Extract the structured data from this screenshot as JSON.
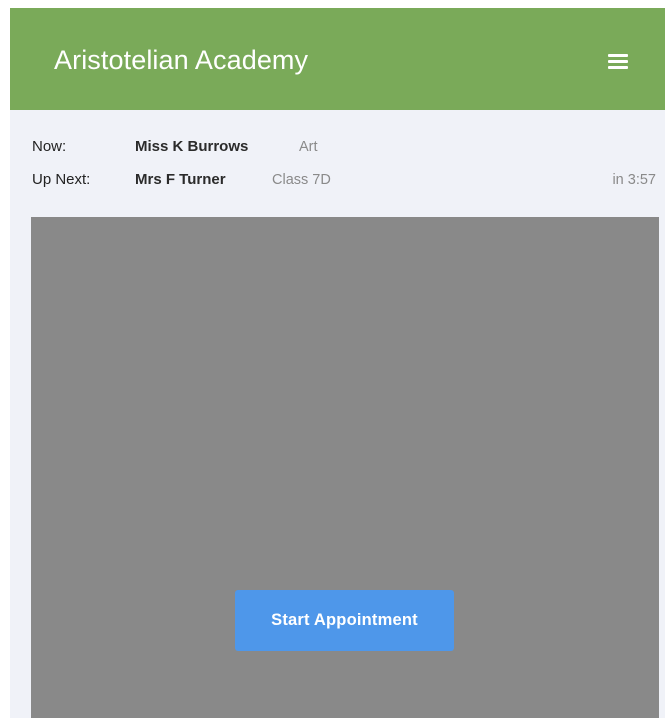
{
  "header": {
    "title": "Aristotelian Academy",
    "menu_icon": "hamburger-menu-icon"
  },
  "schedule": {
    "now": {
      "label": "Now:",
      "teacher": "Miss K Burrows",
      "subject": "Art"
    },
    "up_next": {
      "label": "Up Next:",
      "teacher": "Mrs F Turner",
      "subject": "Class 7D",
      "countdown": "in 3:57"
    }
  },
  "video": {
    "start_label": "Start Appointment"
  },
  "colors": {
    "header": "#7aaa59",
    "background": "#f0f2f8",
    "video_area": "#898989",
    "button": "#4e97ea"
  }
}
